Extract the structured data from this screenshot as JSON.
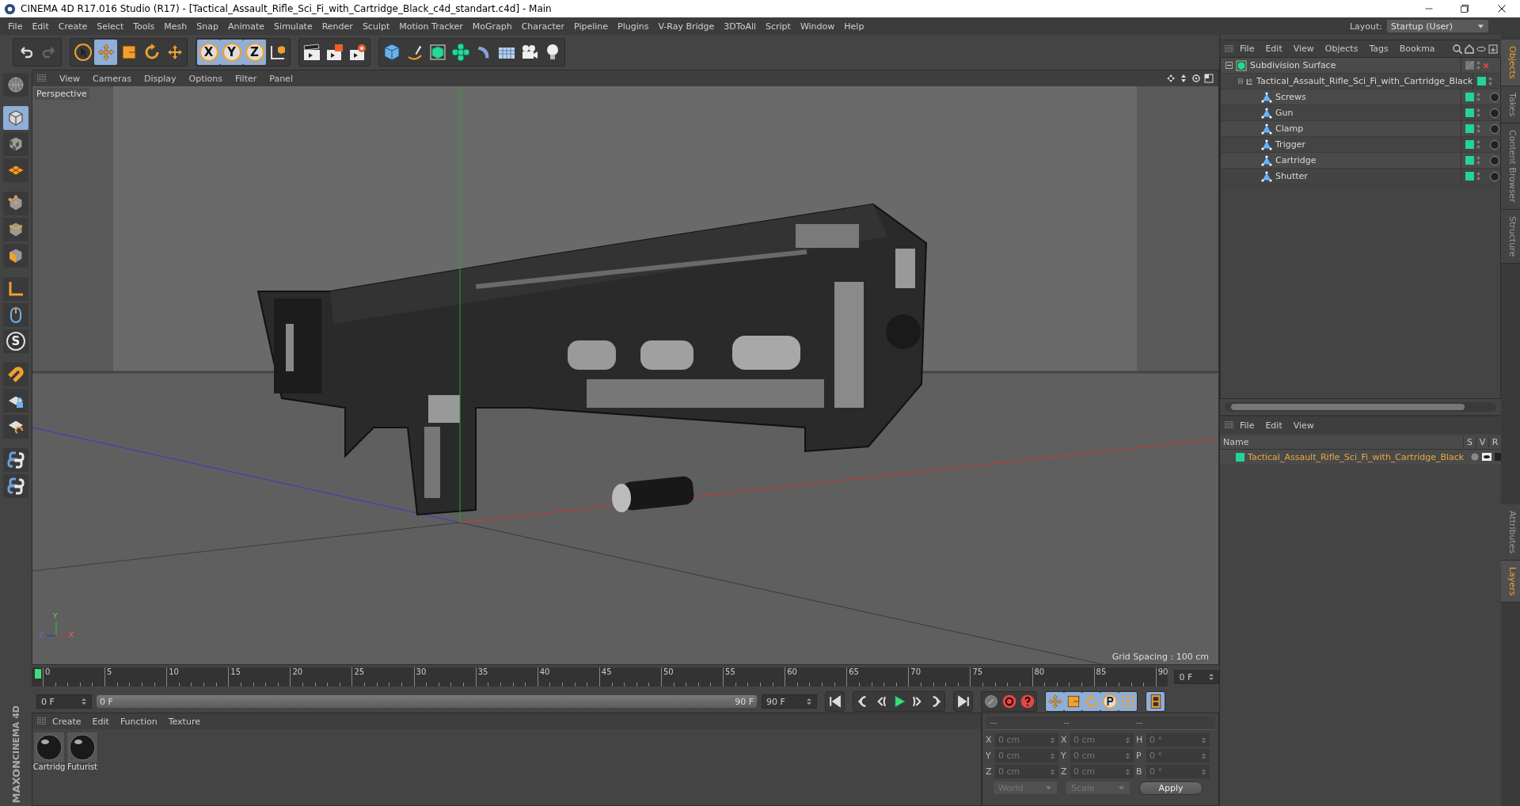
{
  "title_bar": {
    "title": "CINEMA 4D R17.016 Studio (R17) - [Tactical_Assault_Rifle_Sci_Fi_with_Cartridge_Black_c4d_standart.c4d] - Main"
  },
  "menu_bar": {
    "items": [
      "File",
      "Edit",
      "Create",
      "Select",
      "Tools",
      "Mesh",
      "Snap",
      "Animate",
      "Simulate",
      "Render",
      "Sculpt",
      "Motion Tracker",
      "MoGraph",
      "Character",
      "Pipeline",
      "Plugins",
      "V-Ray Bridge",
      "3DToAll",
      "Script",
      "Window",
      "Help"
    ],
    "layout_label": "Layout:",
    "layout_value": "Startup (User)"
  },
  "toolbar": {
    "tools": [
      {
        "selected": false
      },
      {
        "selected": false
      },
      {
        "selected": false
      },
      {
        "selected": true
      },
      {
        "selected": false
      },
      {
        "selected": false
      },
      {
        "selected": false
      },
      {
        "label": "X",
        "selected": true
      },
      {
        "label": "Y",
        "selected": true
      },
      {
        "label": "Z",
        "selected": true
      },
      {
        "selected": false
      },
      {
        "selected": false
      },
      {
        "selected": false
      },
      {
        "selected": false
      },
      {
        "selected": false
      },
      {
        "selected": false
      },
      {
        "selected": false
      },
      {
        "selected": false
      },
      {
        "selected": false
      },
      {
        "selected": false
      },
      {
        "selected": false
      },
      {
        "selected": false
      }
    ]
  },
  "left_toolbar": {
    "tools": [
      {
        "selected": false
      },
      {
        "selected": true
      },
      {
        "selected": false
      },
      {
        "selected": false
      },
      {
        "selected": false
      },
      {
        "selected": false
      },
      {
        "selected": false
      },
      {
        "selected": false
      },
      {
        "selected": false
      },
      {
        "label": "S",
        "selected": false
      },
      {
        "selected": false
      },
      {
        "selected": false
      },
      {
        "selected": false
      },
      {
        "selected": false
      },
      {
        "selected": false
      }
    ]
  },
  "viewport": {
    "menu": [
      "View",
      "Cameras",
      "Display",
      "Options",
      "Filter",
      "Panel"
    ],
    "camera_label": "Perspective",
    "grid_spacing": "Grid Spacing : 100 cm",
    "axis_labels": [
      "Y",
      "Z",
      "X"
    ]
  },
  "timeline": {
    "ticks": [
      "0",
      "5",
      "10",
      "15",
      "20",
      "25",
      "30",
      "35",
      "40",
      "45",
      "50",
      "55",
      "60",
      "65",
      "70",
      "75",
      "80",
      "85",
      "90"
    ],
    "current_frame": "0 F",
    "start_field": "0 F",
    "range_slider": {
      "start": "0 F",
      "end": "90 F",
      "level": 1
    },
    "end_field": "90 F",
    "tools": [
      {
        "selected": false
      },
      {
        "selected": false
      },
      {
        "selected": false
      },
      {
        "selected": false
      },
      {
        "selected": false
      },
      {
        "selected": false
      },
      {
        "selected": false
      },
      {
        "selected": false
      },
      {
        "selected": false
      },
      {
        "selected": false
      },
      {
        "selected": true
      },
      {
        "selected": true
      },
      {
        "selected": true
      },
      {
        "selected": true
      },
      {
        "selected": true
      },
      {
        "selected": true
      }
    ]
  },
  "material_manager": {
    "menu": [
      "Create",
      "Edit",
      "Function",
      "Texture"
    ],
    "materials": [
      {
        "name": "Cartridg"
      },
      {
        "name": "Futurist"
      }
    ]
  },
  "coordinates": {
    "headers": [
      "--",
      "--",
      "--"
    ],
    "rows": [
      {
        "axis": "X",
        "position": "0 cm",
        "size_axis": "X",
        "size": "0 cm",
        "rotation_axis": "H",
        "rotation": "0 °"
      },
      {
        "axis": "Y",
        "position": "0 cm",
        "size_axis": "Y",
        "size": "0 cm",
        "rotation_axis": "P",
        "rotation": "0 °"
      },
      {
        "axis": "Z",
        "position": "0 cm",
        "size_axis": "Z",
        "size": "0 cm",
        "rotation_axis": "B",
        "rotation": "0 °"
      }
    ],
    "dropdowns": [
      "World",
      "Scale"
    ],
    "apply": "Apply"
  },
  "object_manager": {
    "menu": [
      "File",
      "Edit",
      "View",
      "Objects",
      "Tags",
      "Bookma"
    ],
    "tree": [
      {
        "name": "Subdivision Surface",
        "kind": "generator",
        "expanded": true,
        "children": [
          {
            "name": "Tactical_Assault_Rifle_Sci_Fi_with_Cartridge_Black",
            "kind": "null",
            "expanded": true,
            "color": "#22d39a",
            "children": [
              {
                "name": "Screws",
                "kind": "polygon",
                "color": "#22d39a"
              },
              {
                "name": "Gun",
                "kind": "polygon",
                "color": "#22d39a"
              },
              {
                "name": "Clamp",
                "kind": "polygon",
                "color": "#22d39a"
              },
              {
                "name": "Trigger",
                "kind": "polygon",
                "color": "#22d39a"
              },
              {
                "name": "Cartridge",
                "kind": "polygon",
                "color": "#22d39a"
              },
              {
                "name": "Shutter",
                "kind": "polygon",
                "color": "#22d39a"
              }
            ]
          }
        ]
      }
    ]
  },
  "layer_manager": {
    "menu": [
      "File",
      "Edit",
      "View"
    ],
    "columns": [
      "Name",
      "S",
      "V",
      "R"
    ],
    "layers": [
      {
        "name": "Tactical_Assault_Rifle_Sci_Fi_with_Cartridge_Black",
        "color": "#22d39a"
      }
    ]
  },
  "side_tabs": {
    "top": [
      {
        "label": "Objects",
        "selected": true
      },
      {
        "label": "Takes",
        "selected": false
      },
      {
        "label": "Content Browser",
        "selected": false
      },
      {
        "label": "Structure",
        "selected": false
      }
    ],
    "bottom": [
      {
        "label": "Attributes",
        "selected": false
      },
      {
        "label": "Layers",
        "selected": true
      }
    ]
  },
  "logo": {
    "lines": [
      "MAXON",
      "CINEMA 4D"
    ]
  }
}
